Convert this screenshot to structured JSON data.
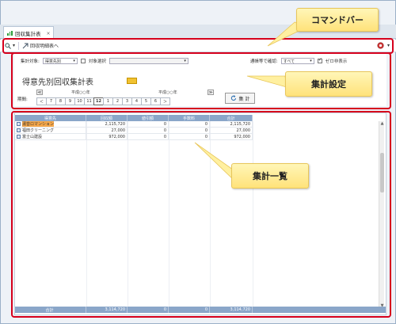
{
  "tab": {
    "label": "回収集計表",
    "close": "×"
  },
  "command_bar": {
    "search_icon": "search-icon",
    "dropdown_glyph": "▾",
    "item_label": "回収明細表へ",
    "help_icon": "help-icon"
  },
  "settings": {
    "target_label": "集計対象:",
    "target_value": "得意先別",
    "target_select_label": "対象選択",
    "ledger_label": "通帳等で確認:",
    "ledger_value": "すべて",
    "zero_hide_label": "ゼロ非表示"
  },
  "report": {
    "title": "得意先別回収集計表",
    "period_label": "期間:",
    "era_left": "平成○○年",
    "era_right": "平成○○年",
    "nav_first": "≪",
    "nav_prev": "＜",
    "nav_next": "＞",
    "nav_last": "≫",
    "months": [
      "7",
      "8",
      "9",
      "10",
      "11",
      "12",
      "1",
      "2",
      "3",
      "4",
      "5",
      "6"
    ],
    "selected_month": "12",
    "calc_label": "集 計"
  },
  "grid": {
    "columns": [
      "得意先",
      "回収額",
      "値引額",
      "手数料",
      "合計"
    ],
    "rows": [
      {
        "name": "湯音ロマンション",
        "collected": "2,115,720",
        "discount": "0",
        "fee": "0",
        "total": "2,115,720",
        "selected": true
      },
      {
        "name": "福田クリーニング",
        "collected": "27,000",
        "discount": "0",
        "fee": "0",
        "total": "27,000",
        "selected": false
      },
      {
        "name": "富士山建設",
        "collected": "972,000",
        "discount": "0",
        "fee": "0",
        "total": "972,000",
        "selected": false
      }
    ],
    "footer": {
      "label": "合計",
      "collected": "3,114,720",
      "discount": "0",
      "fee": "0",
      "total": "3,114,720"
    }
  },
  "callouts": {
    "command_bar": "コマンドバー",
    "settings": "集計設定",
    "list": "集計一覧"
  },
  "colors": {
    "highlight": "#d6001c",
    "callout": "#ffe27a",
    "grid_header": "#8aa6c9",
    "selected_row": "#f7a84a"
  }
}
